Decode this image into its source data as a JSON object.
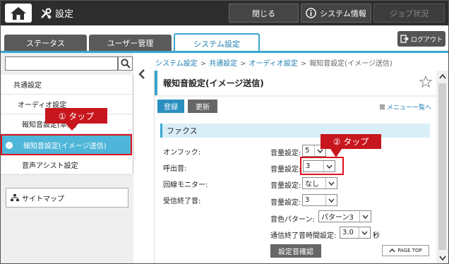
{
  "topbar": {
    "title": "設定",
    "close_label": "閉じる",
    "system_info_label": "システム情報",
    "job_status_label": "ジョブ状況"
  },
  "tabs": {
    "status": "ステータス",
    "user": "ユーザー管理",
    "system": "システム設定",
    "logout": "ログアウト"
  },
  "sidebar": {
    "search_placeholder": "",
    "items": [
      {
        "label": "共通設定"
      },
      {
        "label": "オーディオ設定"
      },
      {
        "label": "報知音設定(本体)"
      },
      {
        "label": "報知音設定(イメージ送信)"
      },
      {
        "label": "音声アシスト設定"
      }
    ],
    "sitemap_label": "サイトマップ"
  },
  "breadcrumb": {
    "items": [
      "システム設定",
      "共通設定",
      "オーディオ設定"
    ],
    "separator": ">",
    "current": "報知音設定(イメージ送信)"
  },
  "page": {
    "title": "報知音設定(イメージ送信)",
    "register_label": "登録",
    "update_label": "更新",
    "menu_list_link": "メニュー一覧へ",
    "section_title": "ファクス",
    "rows": [
      {
        "label": "オンフック:",
        "field_label": "音量設定:",
        "value": "5"
      },
      {
        "label": "呼出音:",
        "field_label": "音量設定:",
        "value": "3"
      },
      {
        "label": "回線モニター:",
        "field_label": "音量設定:",
        "value": "なし"
      },
      {
        "label": "受信終了音:",
        "field_label": "音量設定:",
        "value": "3"
      }
    ],
    "tone_pattern_label": "音色パターン:",
    "tone_pattern_value": "パターン3",
    "end_tone_time_label": "通信終了音時間設定:",
    "end_tone_time_value": "3.0",
    "end_tone_time_unit": "秒",
    "sound_check_label": "設定音確認",
    "page_top_label": "PAGE TOP"
  },
  "annotations": {
    "callout1": "① タップ",
    "callout2": "② タップ",
    "highlight_color": "#e0101e",
    "callout_color": "#c8161e"
  },
  "colors": {
    "accent": "#3aa6cf",
    "topbar": "#2d2d2d",
    "selected_item": "#4fb6d9",
    "link": "#1b7fb0"
  },
  "icons": {
    "home": "home-icon",
    "settings": "wrench-screwdriver-icon",
    "info": "info-circle-icon",
    "logout": "logout-icon",
    "search": "search-icon",
    "collapse": "chevron-left-icon",
    "star": "star-icon",
    "sitemap": "sitemap-icon",
    "menu_list": "list-icon"
  }
}
